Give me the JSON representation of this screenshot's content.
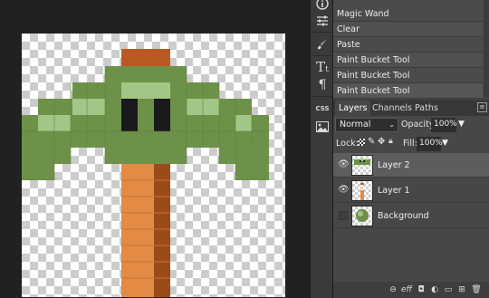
{
  "history": {
    "items": [
      {
        "label": "Magic Wand"
      },
      {
        "label": "Clear"
      },
      {
        "label": "Paste"
      },
      {
        "label": "Paint Bucket Tool"
      },
      {
        "label": "Paint Bucket Tool"
      },
      {
        "label": "Paint Bucket Tool"
      }
    ]
  },
  "layers_panel": {
    "tabs": [
      {
        "label": "Layers"
      },
      {
        "label": "Channels"
      },
      {
        "label": "Paths"
      }
    ],
    "blend_mode": "Normal",
    "opacity_label": "Opacity:",
    "opacity_value": "100%",
    "lock_label": "Lock:",
    "fill_label": "Fill:",
    "fill_value": "100%",
    "layers": [
      {
        "name": "Layer 2"
      },
      {
        "name": "Layer 1"
      },
      {
        "name": "Background"
      }
    ]
  },
  "tool_strip": {
    "css_label": "CSS"
  },
  "colors": {
    "wood_light": "#e8904a",
    "wood_dark": "#a9521f",
    "leaf": "#6d8f4a",
    "leaf_light": "#9ec07a",
    "eye": "#1a1a1a"
  }
}
